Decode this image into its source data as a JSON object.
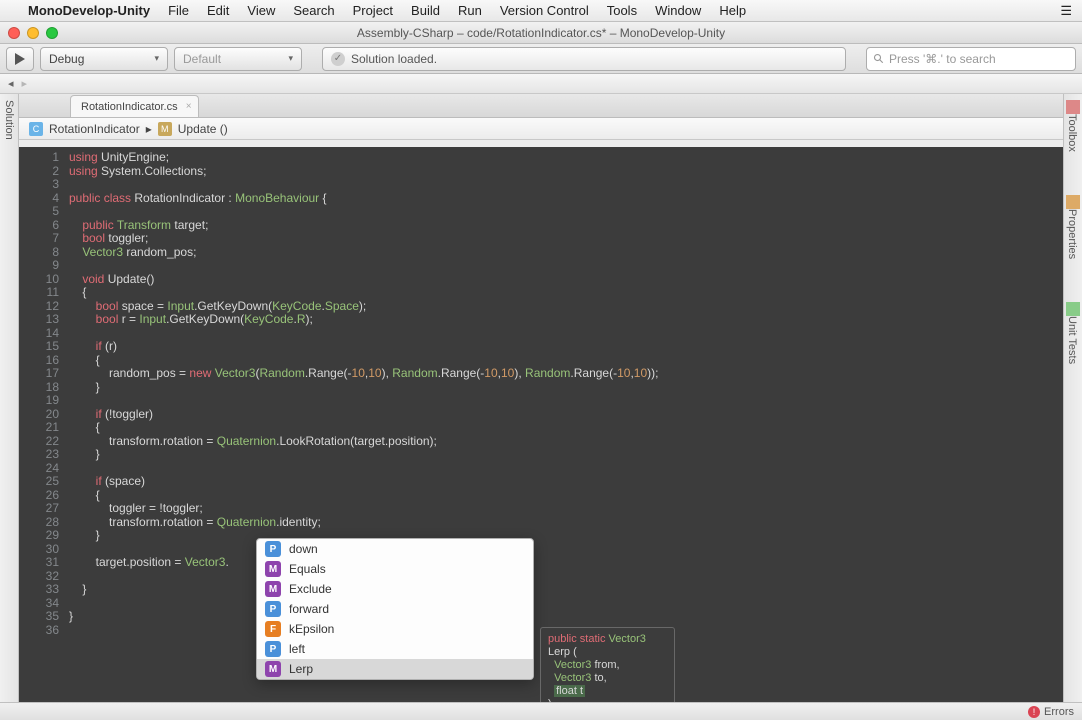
{
  "menubar": {
    "app": "MonoDevelop-Unity",
    "items": [
      "File",
      "Edit",
      "View",
      "Search",
      "Project",
      "Build",
      "Run",
      "Version Control",
      "Tools",
      "Window",
      "Help"
    ]
  },
  "window": {
    "title": "Assembly-CSharp – code/RotationIndicator.cs* – MonoDevelop-Unity"
  },
  "toolbar": {
    "config": "Debug",
    "target": "Default",
    "status": "Solution loaded.",
    "search_placeholder": "Press '⌘.' to search"
  },
  "tab": {
    "name": "RotationIndicator.cs"
  },
  "breadcrumb": {
    "class": "RotationIndicator",
    "method": "Update ()"
  },
  "side": {
    "left": "Solution",
    "right": [
      "Toolbox",
      "Properties",
      "Unit Tests"
    ]
  },
  "footer": {
    "errors": "Errors"
  },
  "autocomplete": {
    "items": [
      {
        "kind": "p",
        "label": "down"
      },
      {
        "kind": "m",
        "label": "Equals"
      },
      {
        "kind": "m",
        "label": "Exclude"
      },
      {
        "kind": "p",
        "label": "forward"
      },
      {
        "kind": "f",
        "label": "kEpsilon"
      },
      {
        "kind": "p",
        "label": "left"
      },
      {
        "kind": "m",
        "label": "Lerp"
      }
    ],
    "selected": 6
  },
  "tooltip": {
    "sig": "public static Vector3",
    "name": "Lerp (",
    "p1": "Vector3 from,",
    "p2": "Vector3 to,",
    "p3": "float t"
  },
  "code": {
    "lines": [
      [
        {
          "t": "using ",
          "c": "kw"
        },
        {
          "t": "UnityEngine;",
          "c": "id"
        }
      ],
      [
        {
          "t": "using ",
          "c": "kw"
        },
        {
          "t": "System.Collections;",
          "c": "id"
        }
      ],
      [
        {
          "t": "",
          "c": "id"
        }
      ],
      [
        {
          "t": "public class ",
          "c": "kw"
        },
        {
          "t": "RotationIndicator : ",
          "c": "id"
        },
        {
          "t": "MonoBehaviour",
          "c": "ty"
        },
        {
          "t": " {",
          "c": "id"
        }
      ],
      [
        {
          "t": "",
          "c": "id"
        }
      ],
      [
        {
          "t": "    public ",
          "c": "kw"
        },
        {
          "t": "Transform",
          "c": "ty"
        },
        {
          "t": " target;",
          "c": "id"
        }
      ],
      [
        {
          "t": "    bool",
          "c": "kw"
        },
        {
          "t": " toggler;",
          "c": "id"
        }
      ],
      [
        {
          "t": "    Vector3",
          "c": "ty"
        },
        {
          "t": " random_pos;",
          "c": "id"
        }
      ],
      [
        {
          "t": "",
          "c": "id"
        }
      ],
      [
        {
          "t": "    void ",
          "c": "kw"
        },
        {
          "t": "Update()",
          "c": "id"
        }
      ],
      [
        {
          "t": "    {",
          "c": "id"
        }
      ],
      [
        {
          "t": "        bool",
          "c": "kw"
        },
        {
          "t": " space = ",
          "c": "id"
        },
        {
          "t": "Input",
          "c": "ty"
        },
        {
          "t": ".GetKeyDown(",
          "c": "id"
        },
        {
          "t": "KeyCode",
          "c": "ty"
        },
        {
          "t": ".",
          "c": "id"
        },
        {
          "t": "Space",
          "c": "ty"
        },
        {
          "t": ");",
          "c": "id"
        }
      ],
      [
        {
          "t": "        bool",
          "c": "kw"
        },
        {
          "t": " r = ",
          "c": "id"
        },
        {
          "t": "Input",
          "c": "ty"
        },
        {
          "t": ".GetKeyDown(",
          "c": "id"
        },
        {
          "t": "KeyCode",
          "c": "ty"
        },
        {
          "t": ".",
          "c": "id"
        },
        {
          "t": "R",
          "c": "ty"
        },
        {
          "t": ");",
          "c": "id"
        }
      ],
      [
        {
          "t": "",
          "c": "id"
        }
      ],
      [
        {
          "t": "        if",
          "c": "kw"
        },
        {
          "t": " (r)",
          "c": "id"
        }
      ],
      [
        {
          "t": "        {",
          "c": "id"
        }
      ],
      [
        {
          "t": "            random_pos = ",
          "c": "id"
        },
        {
          "t": "new ",
          "c": "kw"
        },
        {
          "t": "Vector3",
          "c": "ty"
        },
        {
          "t": "(",
          "c": "id"
        },
        {
          "t": "Random",
          "c": "ty"
        },
        {
          "t": ".Range(-",
          "c": "id"
        },
        {
          "t": "10",
          "c": "num"
        },
        {
          "t": ",",
          "c": "id"
        },
        {
          "t": "10",
          "c": "num"
        },
        {
          "t": "), ",
          "c": "id"
        },
        {
          "t": "Random",
          "c": "ty"
        },
        {
          "t": ".Range(-",
          "c": "id"
        },
        {
          "t": "10",
          "c": "num"
        },
        {
          "t": ",",
          "c": "id"
        },
        {
          "t": "10",
          "c": "num"
        },
        {
          "t": "), ",
          "c": "id"
        },
        {
          "t": "Random",
          "c": "ty"
        },
        {
          "t": ".Range(-",
          "c": "id"
        },
        {
          "t": "10",
          "c": "num"
        },
        {
          "t": ",",
          "c": "id"
        },
        {
          "t": "10",
          "c": "num"
        },
        {
          "t": "));",
          "c": "id"
        }
      ],
      [
        {
          "t": "        }",
          "c": "id"
        }
      ],
      [
        {
          "t": "",
          "c": "id"
        }
      ],
      [
        {
          "t": "        if",
          "c": "kw"
        },
        {
          "t": " (!toggler)",
          "c": "id"
        }
      ],
      [
        {
          "t": "        {",
          "c": "id"
        }
      ],
      [
        {
          "t": "            transform.rotation = ",
          "c": "id"
        },
        {
          "t": "Quaternion",
          "c": "ty"
        },
        {
          "t": ".LookRotation(target.position);",
          "c": "id"
        }
      ],
      [
        {
          "t": "        }",
          "c": "id"
        }
      ],
      [
        {
          "t": "",
          "c": "id"
        }
      ],
      [
        {
          "t": "        if",
          "c": "kw"
        },
        {
          "t": " (space)",
          "c": "id"
        }
      ],
      [
        {
          "t": "        {",
          "c": "id"
        }
      ],
      [
        {
          "t": "            toggler = !toggler;",
          "c": "id"
        }
      ],
      [
        {
          "t": "            transform.rotation = ",
          "c": "id"
        },
        {
          "t": "Quaternion",
          "c": "ty"
        },
        {
          "t": ".identity;",
          "c": "id"
        }
      ],
      [
        {
          "t": "        }",
          "c": "id"
        }
      ],
      [
        {
          "t": "",
          "c": "id"
        }
      ],
      [
        {
          "t": "        target.position = ",
          "c": "id"
        },
        {
          "t": "Vector3",
          "c": "ty"
        },
        {
          "t": ".",
          "c": "id"
        }
      ],
      [
        {
          "t": "",
          "c": "id"
        }
      ],
      [
        {
          "t": "    }",
          "c": "id"
        }
      ],
      [
        {
          "t": "",
          "c": "id"
        }
      ],
      [
        {
          "t": "}",
          "c": "id"
        }
      ],
      [
        {
          "t": "",
          "c": "id"
        }
      ]
    ]
  }
}
